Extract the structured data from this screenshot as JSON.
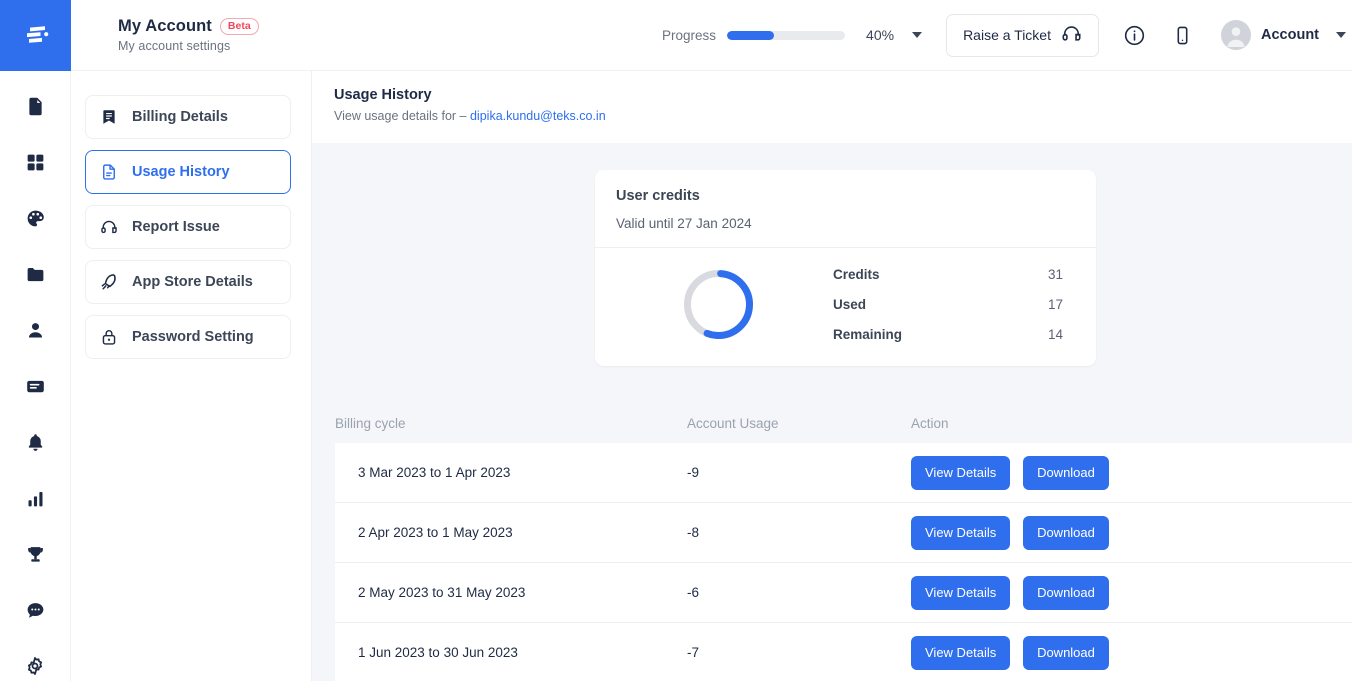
{
  "brand": {
    "accent": "#2f6fed",
    "logo_icon": "stacked-bars-logo"
  },
  "header": {
    "title": "My Account",
    "badge": "Beta",
    "subtitle": "My account settings",
    "progress_label": "Progress",
    "progress_percent": "40%",
    "progress_value": 40,
    "raise_ticket_label": "Raise a Ticket",
    "raise_ticket_icon": "headset-icon",
    "info_icon": "info-circle-icon",
    "mobile_icon": "mobile-phone-icon",
    "account_label": "Account",
    "avatar_icon": "user-avatar-icon",
    "caret_icon": "chevron-down-icon"
  },
  "rail": {
    "items": [
      {
        "icon": "document-icon"
      },
      {
        "icon": "grid-dashboard-icon"
      },
      {
        "icon": "palette-icon"
      },
      {
        "icon": "folder-icon"
      },
      {
        "icon": "person-icon"
      },
      {
        "icon": "card-icon"
      },
      {
        "icon": "bell-icon"
      },
      {
        "icon": "bar-chart-icon"
      },
      {
        "icon": "trophy-icon"
      },
      {
        "icon": "chat-bubble-icon"
      },
      {
        "icon": "gear-icon"
      }
    ]
  },
  "nav": {
    "items": [
      {
        "label": "Billing Details",
        "icon": "bookmark-list-icon",
        "active": false
      },
      {
        "label": "Usage History",
        "icon": "file-lines-icon",
        "active": true
      },
      {
        "label": "Report Issue",
        "icon": "headset-icon",
        "active": false
      },
      {
        "label": "App Store Details",
        "icon": "rocket-icon",
        "active": false
      },
      {
        "label": "Password Setting",
        "icon": "lock-icon",
        "active": false
      }
    ]
  },
  "page": {
    "title": "Usage History",
    "subtitle_prefix": "View usage details for –",
    "subtitle_email": "dipika.kundu@teks.co.in"
  },
  "credits": {
    "title": "User credits",
    "valid_until": "Valid until 27 Jan 2024",
    "stats": [
      {
        "label": "Credits",
        "value": "31"
      },
      {
        "label": "Used",
        "value": "17"
      },
      {
        "label": "Remaining",
        "value": "14"
      }
    ],
    "donut": {
      "used_fraction": 0.548,
      "arc_color": "#2f6fed",
      "track_color": "#d8dadf"
    }
  },
  "table": {
    "columns": [
      "Billing cycle",
      "Account Usage",
      "Action"
    ],
    "view_label": "View Details",
    "download_label": "Download",
    "rows": [
      {
        "cycle": "3 Mar 2023 to 1 Apr 2023",
        "usage": "-9"
      },
      {
        "cycle": "2 Apr 2023 to 1 May 2023",
        "usage": "-8"
      },
      {
        "cycle": "2 May 2023 to 31 May 2023",
        "usage": "-6"
      },
      {
        "cycle": "1 Jun 2023 to 30 Jun 2023",
        "usage": "-7"
      }
    ]
  }
}
